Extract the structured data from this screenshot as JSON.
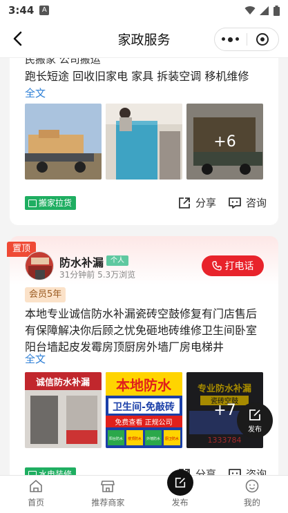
{
  "status_bar": {
    "time": "3:44",
    "notif": "A"
  },
  "header": {
    "title": "家政服务"
  },
  "card1": {
    "cut_line": "民搬家 公司搬运",
    "desc": "跑长短途 回收旧家电 家具 拆装空调 移机维修",
    "more_link": "全文",
    "more_count": "+6",
    "tag": "搬家拉货",
    "share": "分享",
    "consult": "咨询"
  },
  "card2": {
    "top_badge": "置顶",
    "name": "防水补漏",
    "person_badge": "个人",
    "meta": "31分钟前  5.3万浏览",
    "call": "打电话",
    "member": "会员5年",
    "desc": "本地专业诚信防水补漏瓷砖空鼓修复有门店售后有保障解决你后顾之忧免砸地砖维修卫生间卧室阳台墙起皮发霉房顶厨房外墙厂房电梯井",
    "more_link": "全文",
    "more_count": "+7",
    "tag": "水电装修",
    "share": "分享",
    "consult": "咨询",
    "img1": {
      "sign": "诚信防水补漏"
    },
    "img2": {
      "line1": "本地防水",
      "line2": "卫生间-免敲砖",
      "line3": "免费查看  正规公司",
      "chips": [
        "阳台防水",
        "楼顶防水",
        "外墙防水",
        "厨卫防水"
      ]
    },
    "img3": {
      "line1": "专业防水补漏",
      "line2": "瓷砖空鼓",
      "phone": "1333784"
    }
  },
  "fab": {
    "label": "发布"
  },
  "tabbar": {
    "items": [
      {
        "label": "首页"
      },
      {
        "label": "推荐商家"
      },
      {
        "label": "发布"
      },
      {
        "label": "我的"
      }
    ]
  }
}
